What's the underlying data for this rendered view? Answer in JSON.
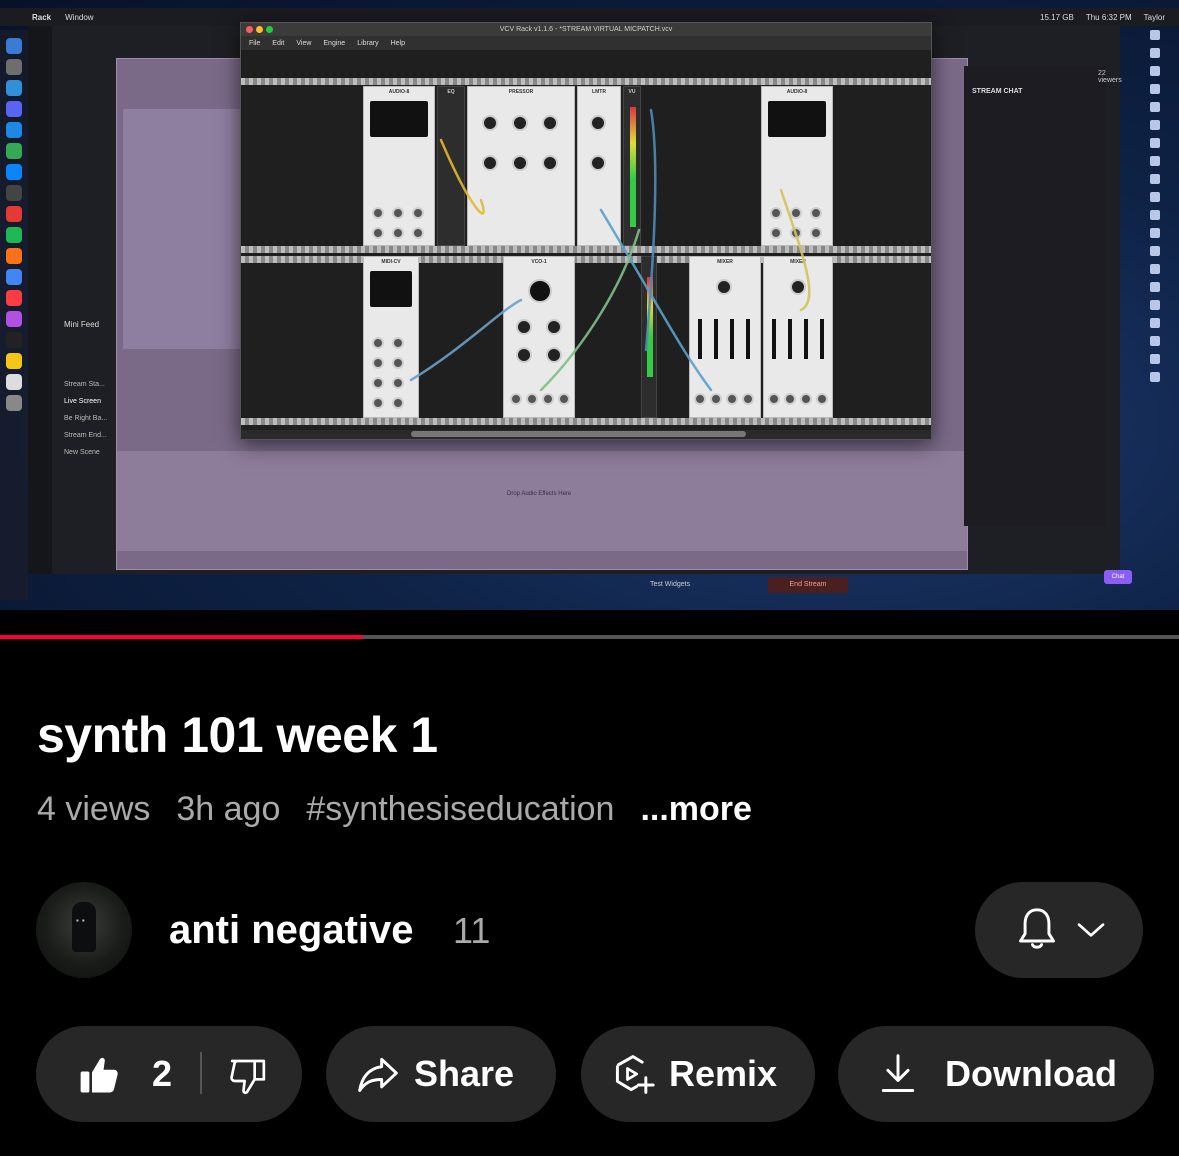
{
  "colors": {
    "progress": "#ff0033",
    "pill_bg": "#272727",
    "meta_text": "#aaaaaa",
    "background": "#000000"
  },
  "player": {
    "progress_fraction": 0.308,
    "screen": {
      "menubar": {
        "app": "Rack",
        "window_menu": "Window",
        "storage": "15.17 GB",
        "clock": "Thu 6:32 PM",
        "user": "Taylor"
      },
      "rack_window": {
        "title": "VCV Rack v1.1.6 - *STREAM VIRTUAL MICPATCH.vcv",
        "menu": [
          "File",
          "Edit",
          "View",
          "Engine",
          "Library",
          "Help"
        ],
        "modules": {
          "audio_left": "AUDIO-8",
          "eq": "EQ",
          "pressor": "PRESSOR",
          "lmtr": "LMTR",
          "vu": "VU",
          "audio_right": "AUDIO-8",
          "midi": "MIDI-CV",
          "vco": "VCO-1",
          "mixer_a": "MIXER",
          "mixer_b": "MIXER"
        }
      },
      "obs": {
        "mini_feed": "Mini Feed",
        "scenes": [
          "Stream Sta...",
          "Live Screen",
          "Be Right Ba...",
          "Stream End...",
          "New Scene"
        ],
        "drop_effects": "Drop Audio Effects Here",
        "chat_header": "STREAM CHAT",
        "viewers": "22 viewers",
        "test_widgets": "Test Widgets",
        "end_stream": "End Stream",
        "chat_button": "Chat"
      }
    }
  },
  "video": {
    "title": "synth 101 week 1",
    "views": "4 views",
    "age": "3h ago",
    "hashtag": "#synthesiseducation",
    "more": "...more"
  },
  "channel": {
    "name": "anti negative",
    "subscribers": "11",
    "avatar_icon": "channel-avatar",
    "subscribe_icons": [
      "bell-icon",
      "chevron-down-icon"
    ]
  },
  "actions": {
    "like_count": "2",
    "like_icon": "thumbs-up-icon",
    "dislike_icon": "thumbs-down-icon",
    "share": "Share",
    "remix": "Remix",
    "download": "Download"
  }
}
